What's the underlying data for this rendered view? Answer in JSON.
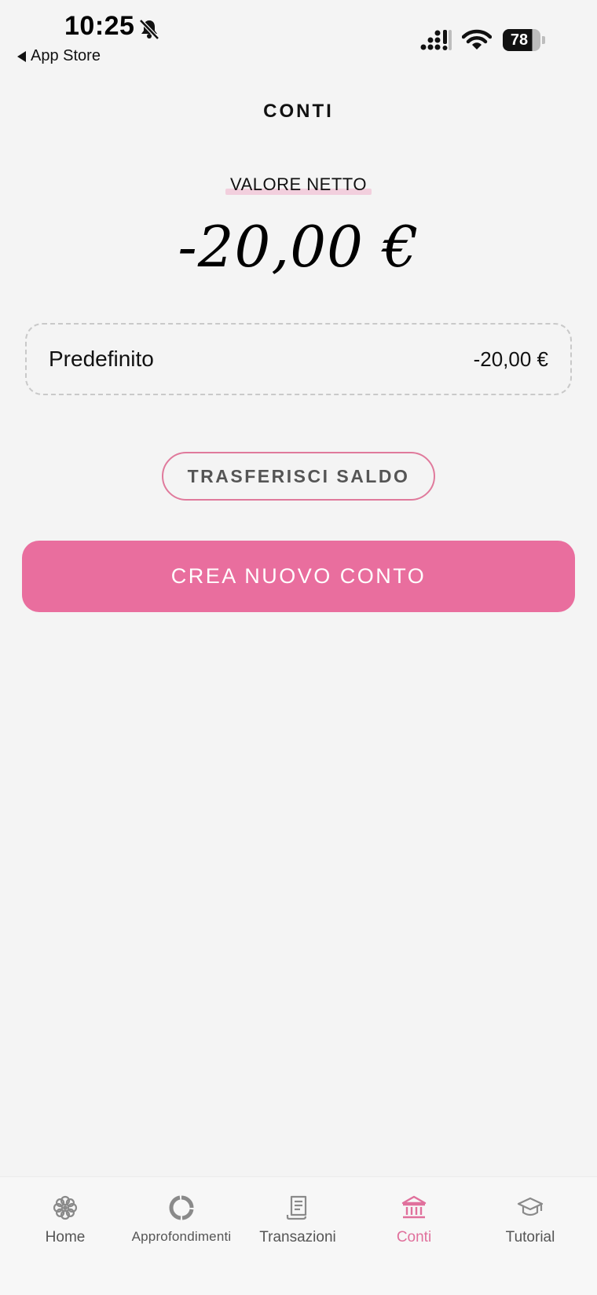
{
  "status_bar": {
    "time": "10:25",
    "back_label": "App Store",
    "battery": "78"
  },
  "header": {
    "title": "CONTI"
  },
  "summary": {
    "net_label": "VALORE NETTO",
    "net_value": "-20,00 €"
  },
  "accounts": [
    {
      "name": "Predefinito",
      "balance": "-20,00 €"
    }
  ],
  "actions": {
    "transfer_label": "TRASFERISCI SALDO",
    "create_label": "CREA NUOVO CONTO"
  },
  "tabs": [
    {
      "label": "Home",
      "icon": "flower-icon",
      "active": false
    },
    {
      "label": "Approfondimenti",
      "icon": "ring-chart-icon",
      "active": false
    },
    {
      "label": "Transazioni",
      "icon": "receipt-icon",
      "active": false
    },
    {
      "label": "Conti",
      "icon": "bank-icon",
      "active": true
    },
    {
      "label": "Tutorial",
      "icon": "graduation-cap-icon",
      "active": false
    }
  ],
  "colors": {
    "accent": "#e96e9e",
    "accent_border": "#e07a9c",
    "active_tab": "#e0709c",
    "background": "#f4f4f4"
  }
}
